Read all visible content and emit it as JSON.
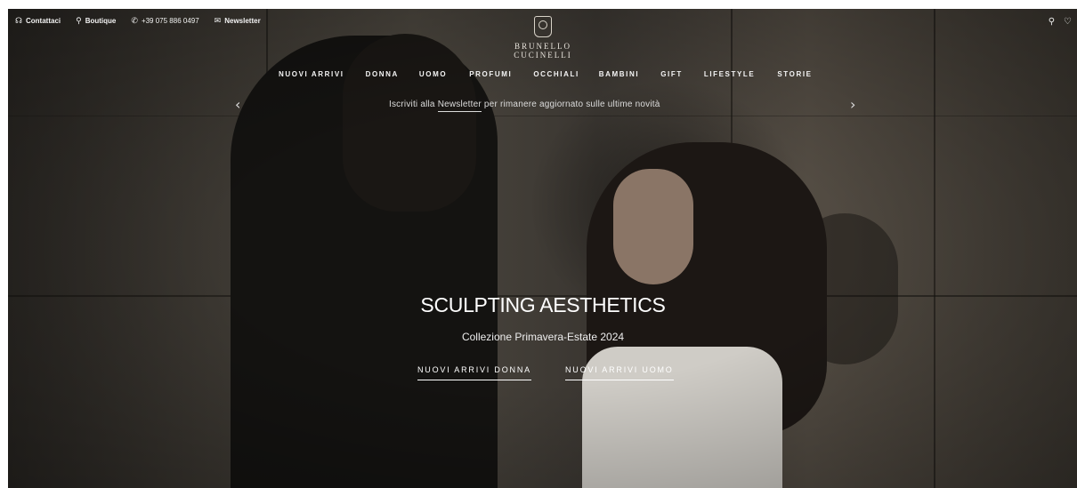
{
  "utility_bar": {
    "contact": "Contattaci",
    "boutique": "Boutique",
    "phone": "+39 075 886 0497",
    "newsletter": "Newsletter"
  },
  "brand": {
    "name": "BRUNELLO CUCINELLI"
  },
  "nav": {
    "items": [
      "NUOVI ARRIVI",
      "DONNA",
      "UOMO",
      "PROFUMI",
      "OCCHIALI",
      "BAMBINI",
      "GIFT",
      "LIFESTYLE",
      "STORIE"
    ]
  },
  "promo": {
    "before": "Iscriviti alla ",
    "link": "Newsletter",
    "after": " per rimanere aggiornato sulle ultime novità"
  },
  "hero": {
    "title": "SCULPTING AESTHETICS",
    "subtitle": "Collezione Primavera-Estate 2024",
    "cta_women": "NUOVI ARRIVI DONNA",
    "cta_men": "NUOVI ARRIVI UOMO"
  },
  "icons": {
    "contact": "headset-icon",
    "boutique": "location-pin-icon",
    "phone": "phone-icon",
    "newsletter": "envelope-icon",
    "search": "search-icon",
    "wishlist": "heart-icon"
  }
}
